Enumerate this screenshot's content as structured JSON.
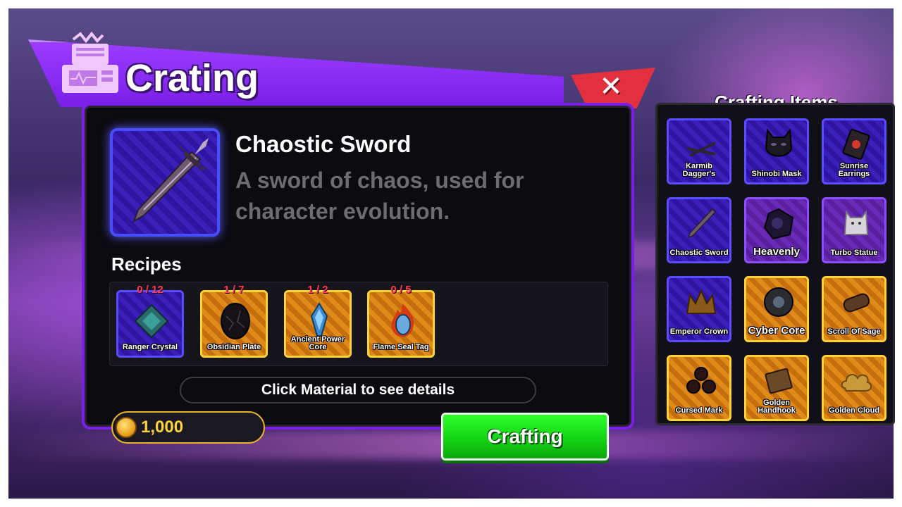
{
  "header": {
    "title": "Crating",
    "close_symbol": "✕"
  },
  "selected_item": {
    "name": "Chaostic Sword",
    "description": "A sword of chaos, used for character evolution."
  },
  "recipes": {
    "title": "Recipes",
    "materials": [
      {
        "label": "Ranger Crystal",
        "count": "0 / 12",
        "rarity": "epic"
      },
      {
        "label": "Obsidian Plate",
        "count": "1 / 7",
        "rarity": "legendary"
      },
      {
        "label": "Ancient Power Core",
        "count": "1 / 2",
        "rarity": "legendary"
      },
      {
        "label": "Flame Seal Tag",
        "count": "0 / 5",
        "rarity": "legendary"
      }
    ]
  },
  "hint": "Click Material to see details",
  "currency": {
    "value": "1,000",
    "icon": "gold-coin-icon"
  },
  "craft_button_label": "Crafting",
  "crafting_items": {
    "title": "Crafting Items",
    "items": [
      {
        "label": "Karmib Dagger's",
        "rarity": "epic"
      },
      {
        "label": "Shinobi Mask",
        "rarity": "epic"
      },
      {
        "label": "Sunrise Earrings",
        "rarity": "epic"
      },
      {
        "label": "Chaostic Sword",
        "rarity": "epic"
      },
      {
        "label": "Heavenly",
        "rarity": "mythic"
      },
      {
        "label": "Turbo Statue",
        "rarity": "mythic"
      },
      {
        "label": "Emperor Crown",
        "rarity": "epic"
      },
      {
        "label": "Cyber Core",
        "rarity": "legendary"
      },
      {
        "label": "Scroll Of Sage",
        "rarity": "legendary"
      },
      {
        "label": "Cursed Mark",
        "rarity": "legendary"
      },
      {
        "label": "Golden Handhook",
        "rarity": "legendary"
      },
      {
        "label": "Golden Cloud",
        "rarity": "legendary"
      }
    ]
  },
  "colors": {
    "accent_purple": "#7a1fe8",
    "close_red": "#e3303f",
    "craft_green": "#12d012",
    "coin_gold": "#ffd23a",
    "count_red": "#ff3a55"
  }
}
